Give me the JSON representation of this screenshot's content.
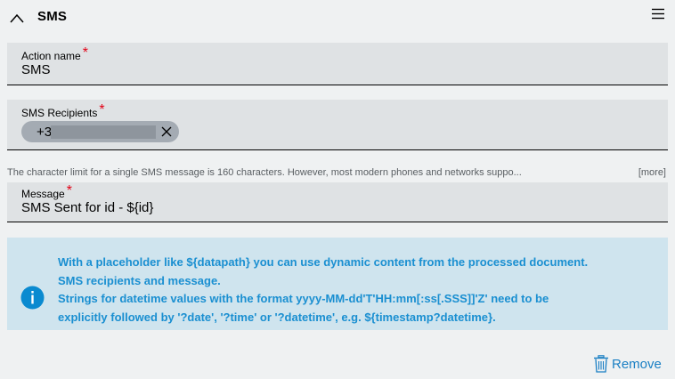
{
  "header": {
    "title": "SMS",
    "collapse_icon": "chevron-up-icon",
    "menu_icon": "hamburger-menu-icon"
  },
  "fields": {
    "action_name": {
      "label": "Action name",
      "required_mark": "*",
      "value": "SMS"
    },
    "recipients": {
      "label": "SMS Recipients",
      "required_mark": "*",
      "chips": [
        {
          "visible_text": "+3",
          "redacted": true
        }
      ]
    },
    "message": {
      "label": "Message",
      "required_mark": "*",
      "value": "SMS Sent for id - ${id}"
    }
  },
  "hint": {
    "text": "The character limit for a single SMS message is 160 characters. However, most modern phones and networks suppo...",
    "more_label": "[more]"
  },
  "info": {
    "icon": "info-icon",
    "lines": [
      "With a placeholder like ${datapath} you can use dynamic content from the processed document.",
      "SMS recipients and message.",
      "Strings for datetime values with the format yyyy-MM-dd'T'HH:mm[:ss[.SSS]]'Z' need to be",
      "explicitly followed by '?date', '?time' or '?datetime', e.g. ${timestamp?datetime}."
    ]
  },
  "actions": {
    "remove_label": "Remove",
    "remove_icon": "trash-icon"
  },
  "colors": {
    "required": "#e20015",
    "info_bg": "#cfe4ee",
    "info_text": "#1a8fd1",
    "link": "#1a7fc4"
  }
}
